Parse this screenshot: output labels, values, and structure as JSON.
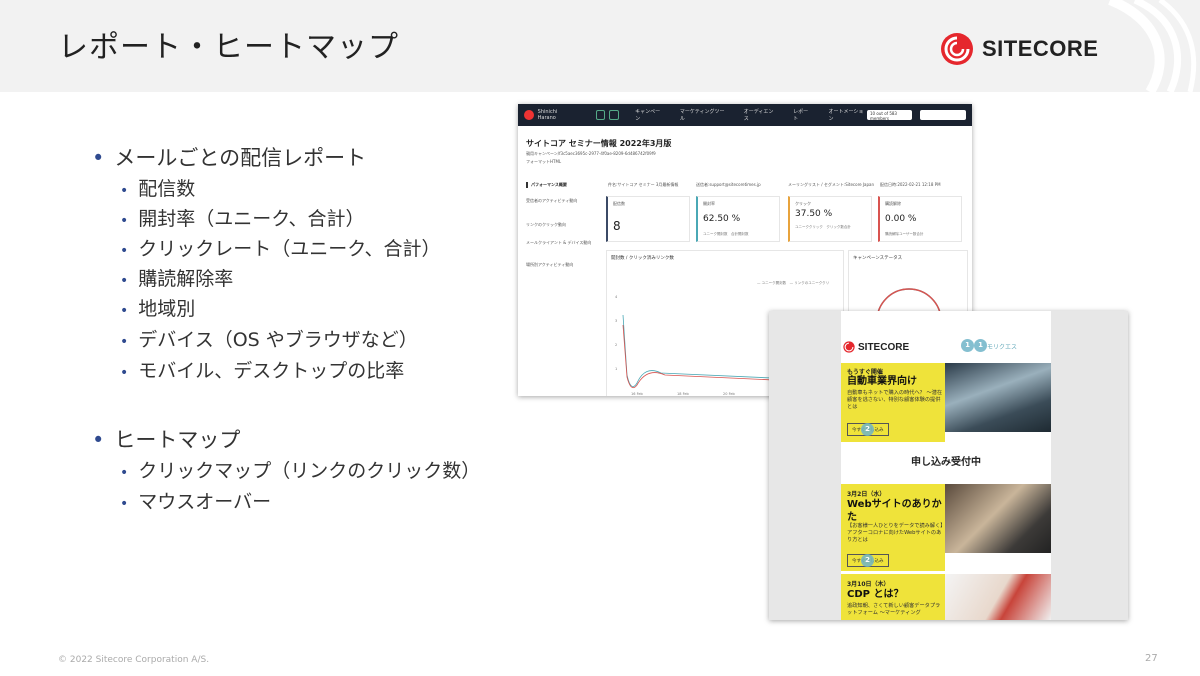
{
  "header": {
    "title": "レポート・ヒートマップ",
    "logo_text": "SITECORE"
  },
  "bullets": {
    "report": {
      "label": "メールごとの配信レポート",
      "items": [
        "配信数",
        "開封率（ユニーク、合計）",
        "クリックレート（ユニーク、合計）",
        "購読解除率",
        "地域別",
        "デバイス（OS やブラウザなど）",
        "モバイル、デスクトップの比率"
      ]
    },
    "heatmap": {
      "label": "ヒートマップ",
      "items": [
        "クリックマップ（リンクのクリック数）",
        "マウスオーバー"
      ]
    }
  },
  "dashboard": {
    "nav_user": "Shinichi Harano",
    "nav_items": [
      "キャンペーン",
      "マーケティングツール",
      "オーディエンス",
      "レポート",
      "オートメーション"
    ],
    "nav_select": "10 out of 583 members",
    "title": "サイトコア セミナー情報 2022年3月版",
    "subtitle": "親用キャンペーン/f3c5aec3695c-2977-4f0ae-8209-6d486742f09f9",
    "subtitle2": "フォーマットHTML",
    "meta": [
      "件名:サイトコア セミナー 3月最新情報",
      "送信者:support@sitecoretimes.jp",
      "メーリングリスト / セグメント:Sitecore Japan",
      "配信日時:2022-02-21 12:18 PM"
    ],
    "sidebar": [
      "パフォーマンス概要",
      "受信者のアクティビティ動向",
      "リンクのクリック動向",
      "メールクライアント & デバイス動向",
      "場所別アクティビティ動向"
    ],
    "kpis": [
      {
        "label": "配信数",
        "value": "8",
        "sub": "",
        "color": "#3b4a66"
      },
      {
        "label": "開封率",
        "value": "62.50 %",
        "sub": "ユニーク開封数　合計開封数",
        "color": "#4aa8b5"
      },
      {
        "label": "クリック",
        "value": "37.50 %",
        "sub": "ユニーククリック　クリック数合計",
        "color": "#e8a33c"
      },
      {
        "label": "購読解除",
        "value": "0.00 %",
        "sub": "購読解除ユーザー数合計",
        "color": "#d9534f"
      }
    ],
    "chart_panel": {
      "title": "開封数 / クリック済みリンク数",
      "legend": [
        "ユニーク開封数",
        "リンクのユニーククリ"
      ],
      "x_ticks": [
        "16 Feb",
        "18 Feb",
        "20 Feb",
        "22 Feb",
        "24 Feb"
      ],
      "y_ticks": [
        "4",
        "3",
        "2",
        "1",
        "0"
      ]
    },
    "status_panel": {
      "title": "キャンペーンステータス"
    }
  },
  "email": {
    "logo_text": "SITECORE",
    "top_text": "モリクエス",
    "block1": {
      "kicker": "もうすぐ開催",
      "title": "自動車業界向け",
      "desc": "自動車もネットで購入の時代へ？ ～潜在顧客を逃さない、特別な顧客体験の提供とは",
      "button": "今すぐ申し込み",
      "badge": "2"
    },
    "apply": "申し込み受付中",
    "block2": {
      "kicker": "3月2日（水）",
      "title": "Webサイトのありかた",
      "desc": "【お客様一人ひとりをデータで読み解く】アフターコロナに向けたWebサイトのあり方とは",
      "button": "今すぐ申し込み",
      "badge": "2"
    },
    "block3": {
      "kicker": "3月10日（木）",
      "title": "CDP とは？",
      "desc": "追政知朝、さくて新しい顧客データプラットフォーム ～マーケティング"
    },
    "top_badges": [
      "1",
      "1"
    ]
  },
  "footer": {
    "copyright": "© 2022 Sitecore Corporation A/S.",
    "page": "27"
  },
  "colors": {
    "bullet": "#2f4a8f",
    "sitecore_red": "#e5272d",
    "email_yellow": "#efe33a"
  }
}
